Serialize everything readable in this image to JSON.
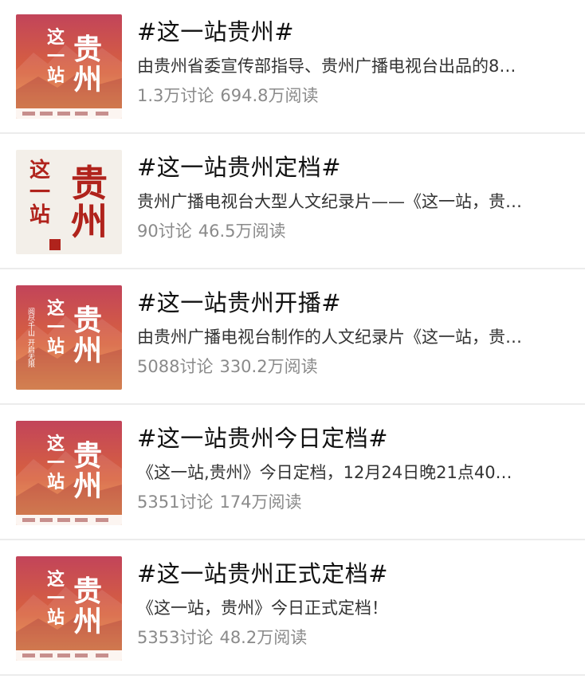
{
  "topics": [
    {
      "title": "#这一站贵州#",
      "description": "由贵州省委宣传部指导、贵州广播电视台出品的8…",
      "discussions": "1.3万讨论",
      "reads": "694.8万阅读",
      "thumbnail": {
        "variant": "poster-orange",
        "calligraphy_left": "这一站",
        "calligraphy_right": "贵州"
      }
    },
    {
      "title": "#这一站贵州定档#",
      "description": "贵州广播电视台大型人文纪录片——《这一站，贵…",
      "discussions": "90讨论",
      "reads": "46.5万阅读",
      "thumbnail": {
        "variant": "poster-white",
        "calligraphy_left": "这一站",
        "calligraphy_right": "贵州"
      }
    },
    {
      "title": "#这一站贵州开播#",
      "description": "由贵州广播电视台制作的人文纪录片《这一站，贵…",
      "discussions": "5088讨论",
      "reads": "330.2万阅读",
      "thumbnail": {
        "variant": "poster-orange-slogan",
        "calligraphy_left": "这一站",
        "calligraphy_right": "贵州",
        "slogan": "阅尽千山 开启无限"
      }
    },
    {
      "title": "#这一站贵州今日定档#",
      "description": "《这一站,贵州》今日定档，12月24日晚21点40…",
      "discussions": "5351讨论",
      "reads": "174万阅读",
      "thumbnail": {
        "variant": "poster-orange",
        "calligraphy_left": "这一站",
        "calligraphy_right": "贵州"
      }
    },
    {
      "title": "#这一站贵州正式定档#",
      "description": "《这一站，贵州》今日正式定档！",
      "discussions": "5353讨论",
      "reads": "48.2万阅读",
      "thumbnail": {
        "variant": "poster-orange",
        "calligraphy_left": "这一站",
        "calligraphy_right": "贵州"
      }
    }
  ],
  "colors": {
    "poster_top": "#c2445a",
    "poster_mid": "#d8623f",
    "poster_bottom": "#e9974a",
    "poster_white_bg": "#f3efe9",
    "calligraphy_red": "#b0231c",
    "title_text": "#111111",
    "desc_text": "#333333",
    "meta_text": "#8a8a8a",
    "divider": "#ececec"
  }
}
